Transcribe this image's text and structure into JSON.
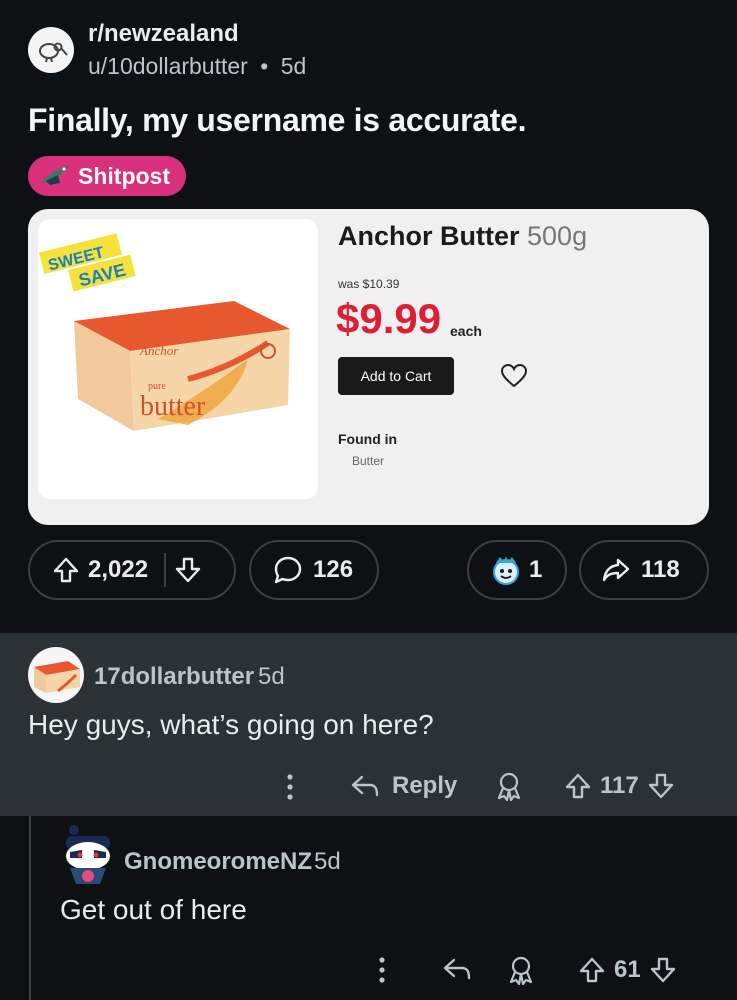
{
  "post": {
    "subreddit": "r/newzealand",
    "author": "u/10dollarbutter",
    "separator": "•",
    "age": "5d",
    "title": "Finally, my username is accurate.",
    "flair": "Shitpost",
    "product": {
      "badge_line1": "SWEET",
      "badge_line2": "SAVE",
      "name": "Anchor Butter",
      "weight": "500g",
      "was_price": "was $10.39",
      "price": "$9.99",
      "unit": "each",
      "add_to_cart": "Add to Cart",
      "found_in_label": "Found in",
      "found_in_value": "Butter",
      "brand": "Anchor",
      "pack_text": "butter",
      "pack_small": "pure"
    },
    "votes": "2,022",
    "comments": "126",
    "awards": "1",
    "shares": "118"
  },
  "comments": [
    {
      "username": "17dollarbutter",
      "age": "5d",
      "body": "Hey guys, what’s going on here?",
      "reply_label": "Reply",
      "votes": "117"
    },
    {
      "username": "GnomeoromeNZ",
      "age": "5d",
      "body": "Get out of here",
      "votes": "61"
    }
  ],
  "colors": {
    "background": "#0e1113",
    "highlight_comment": "#2a3236",
    "flair": "#d9307c",
    "price": "#dc1f35"
  }
}
